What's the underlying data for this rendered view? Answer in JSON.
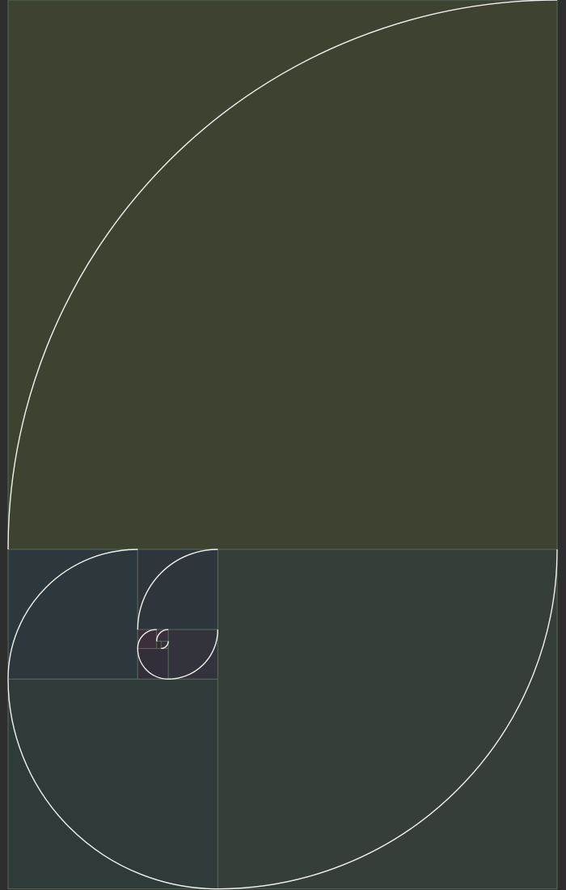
{
  "colors": {
    "page_background": "#2e2e2e",
    "square_1": "#3e4231",
    "square_2": "#353f37",
    "square_3": "#2f3b39",
    "square_4": "#2c383b",
    "square_5": "#2e363c",
    "square_6": "#33333b",
    "square_7": "#322f3a",
    "square_8": "#3a2f3a",
    "square_9": "#3a303c",
    "square_10": "#3b303d",
    "square_border": "#56685b",
    "spiral_stroke": "#f2f2ee"
  }
}
